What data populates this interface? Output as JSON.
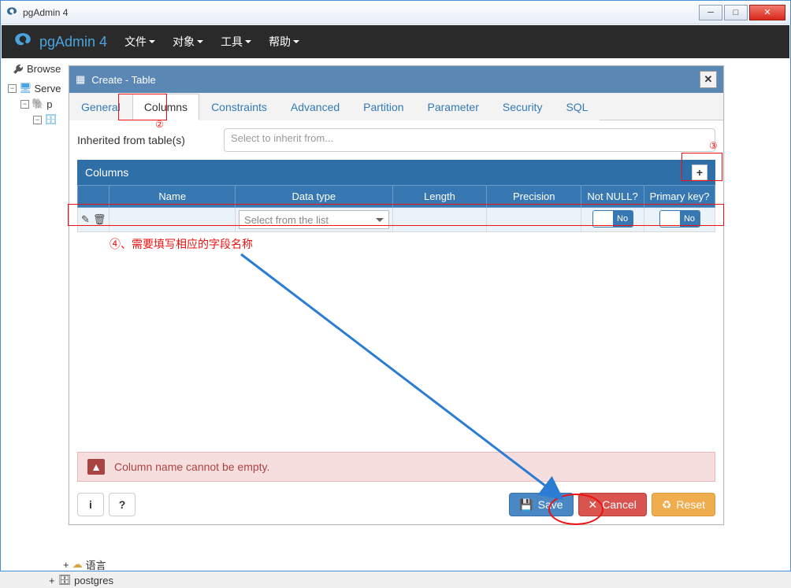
{
  "window_title": "pgAdmin 4",
  "app_name": "pgAdmin 4",
  "menu": {
    "file": "文件",
    "object": "对象",
    "tools": "工具",
    "help": "帮助"
  },
  "browser_label": "Browse",
  "tree": {
    "servers": "Serve",
    "p": "p",
    "lang": "语言",
    "postgres": "postgres"
  },
  "dialog": {
    "title": "Create - Table",
    "tabs": {
      "general": "General",
      "columns": "Columns",
      "constraints": "Constraints",
      "advanced": "Advanced",
      "partition": "Partition",
      "parameter": "Parameter",
      "security": "Security",
      "sql": "SQL"
    },
    "inherit_label": "Inherited from table(s)",
    "inherit_placeholder": "Select to inherit from...",
    "grid_title": "Columns",
    "headers": {
      "name": "Name",
      "datatype": "Data type",
      "length": "Length",
      "precision": "Precision",
      "notnull": "Not NULL?",
      "pk": "Primary key?"
    },
    "row": {
      "datatype_placeholder": "Select from the list",
      "no": "No"
    },
    "error": "Column name cannot be empty.",
    "buttons": {
      "info": "i",
      "help": "?",
      "save": "Save",
      "cancel": "Cancel",
      "reset": "Reset"
    }
  },
  "annotation": {
    "num2": "②",
    "num3": "③",
    "num4": "④、需要填写相应的字段名称"
  }
}
